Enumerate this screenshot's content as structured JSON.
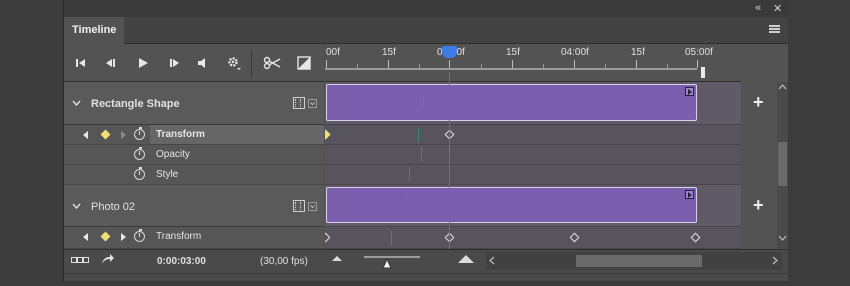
{
  "window": {
    "collapse_glyph": "«",
    "close_glyph": "✕"
  },
  "panel": {
    "tab": "Timeline"
  },
  "ruler": {
    "labels": [
      "00f",
      "15f",
      "01:00f",
      "15f",
      "04:00f",
      "15f",
      "05:00f"
    ]
  },
  "layers": [
    {
      "name": "Rectangle Shape",
      "properties": [
        {
          "label": "Transform"
        },
        {
          "label": "Opacity"
        },
        {
          "label": "Style"
        }
      ]
    },
    {
      "name": "Photo 02",
      "properties": [
        {
          "label": "Transform"
        }
      ]
    }
  ],
  "bottom": {
    "time": "0:00:03:00",
    "fps": "(30,00 fps)"
  },
  "colors": {
    "clip": "#7b5fae",
    "playhead": "#d4406a",
    "playhead_handle": "#3c7be8",
    "keyframe_active": "#f0e070"
  }
}
